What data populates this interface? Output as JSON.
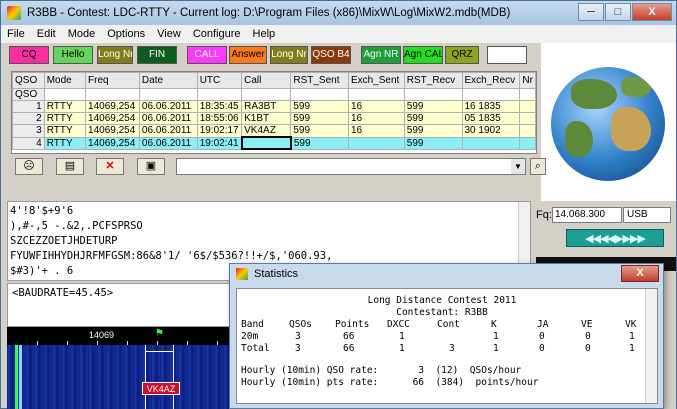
{
  "window": {
    "title": "R3BB - Contest: LDC-RTTY - Current log: D:\\Program Files (x86)\\MixW\\Log\\MixW2.mdb(MDB)",
    "controls": {
      "minimize": "─",
      "maximize": "□",
      "close": "X"
    }
  },
  "menu": [
    "File",
    "Edit",
    "Mode",
    "Options",
    "View",
    "Configure",
    "Help"
  ],
  "toolbar": [
    {
      "label": "CQ",
      "bg": "#ff2da3",
      "fg": "#000000"
    },
    {
      "label": "Hello",
      "bg": "#66d35a",
      "fg": "#000000"
    },
    {
      "label": "Long Nr",
      "bg": "#7f7f1a",
      "fg": "#ffffff"
    },
    {
      "label": "FIN",
      "bg": "#0e5c1d",
      "fg": "#ffffff"
    },
    {
      "label": "CALL",
      "bg": "#ff39ff",
      "fg": "#ffffff"
    },
    {
      "label": "Answer",
      "bg": "#ff7a1a",
      "fg": "#000000"
    },
    {
      "label": "Long Nr",
      "bg": "#7f7f1a",
      "fg": "#ffffff"
    },
    {
      "label": "QSO B4",
      "bg": "#8a3a0a",
      "fg": "#ffffff"
    },
    {
      "label": "Agn NR",
      "bg": "#1d9e3a",
      "fg": "#ffffff"
    },
    {
      "label": "Agn CALL",
      "bg": "#22e11c",
      "fg": "#000000"
    },
    {
      "label": "QRZ",
      "bg": "#8ca61f",
      "fg": "#000000"
    },
    {
      "label": "",
      "bg": "#ffffff",
      "fg": "#000000"
    }
  ],
  "log": {
    "columns": [
      "QSO",
      "Mode",
      "Freq",
      "Date",
      "UTC",
      "Call",
      "RST_Sent",
      "Exch_Sent",
      "RST_Recv",
      "Exch_Recv",
      "Nr"
    ],
    "rows": [
      [
        "QSO",
        "",
        "",
        "",
        "",
        "",
        "",
        "",
        "",
        "",
        ""
      ],
      [
        "1",
        "RTTY",
        "14069,254",
        "06.06.2011",
        "18:35:45",
        "RA3BT",
        "599",
        "16",
        "599",
        "16 1835",
        ""
      ],
      [
        "2",
        "RTTY",
        "14069,254",
        "06.06.2011",
        "18:55:06",
        "K1BT",
        "599",
        "16",
        "599",
        "05 1835",
        ""
      ],
      [
        "3",
        "RTTY",
        "14069,254",
        "06.06.2011",
        "19:02:17",
        "VK4AZ",
        "599",
        "16",
        "599",
        "30 1902",
        ""
      ],
      [
        "4",
        "RTTY",
        "14069,254",
        "06.06.2011",
        "19:02:41",
        "",
        "599",
        "",
        "599",
        "",
        ""
      ]
    ]
  },
  "controls_bar": {
    "buttons": [
      "glasses-icon",
      "card-icon",
      "delete-icon",
      "save-icon"
    ],
    "search_icon": "search-icon"
  },
  "rx_text": [
    "4'!8'$+9'6",
    "),#-,5 -.&2,.PCFSPRSO",
    "SZCEZZOETJHDETURP",
    "FYUWFIHHYDHJRFMFGSM:86&8'1/ '6$/$536?!!+/$,'060.93,",
    "$#3)'+ . 6"
  ],
  "tx_text": "<BAUDRATE=45.45>",
  "waterfall": {
    "ruler_label": "14069",
    "call_badge": "VK4AZ"
  },
  "right": {
    "fq_label": "Fq:",
    "frequency": "14.068.300",
    "mode": "USB",
    "arrows": "◀◀◀◀▶▶▶▶"
  },
  "statistics": {
    "title": "Statistics",
    "close": "X",
    "heading": "Long Distance Contest 2011",
    "contestant": "Contestant: R3BB",
    "columns": [
      "Band",
      "QSOs",
      "Points",
      "DXCC",
      "Cont",
      "K",
      "JA",
      "VE",
      "VK"
    ],
    "rows": [
      [
        "20m",
        "3",
        "66",
        "1",
        "",
        "1",
        "0",
        "0",
        "1"
      ],
      [
        "Total",
        "3",
        "66",
        "1",
        "3",
        "1",
        "0",
        "0",
        "1"
      ]
    ],
    "hourly_qso": "Hourly (10min) QSO rate:       3  (12)  QSOs/hour",
    "hourly_pts": "Hourly (10min) pts rate:      66  (384)  points/hour"
  }
}
